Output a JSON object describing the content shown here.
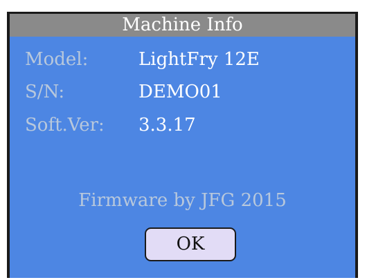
{
  "dialog": {
    "title": "Machine Info",
    "fields": [
      {
        "label": "Model:",
        "value": "LightFry 12E"
      },
      {
        "label": "S/N:",
        "value": "DEMO01"
      },
      {
        "label": "Soft.Ver:",
        "value": "3.3.17"
      }
    ],
    "footer": "Firmware by JFG 2015",
    "ok_label": "OK"
  },
  "colors": {
    "title_bar": "#8a8a8a",
    "content_bg": "#4d86e3",
    "label_text": "#b8c8dc",
    "value_text": "#ffffff",
    "button_bg": "#e2dcf6"
  }
}
